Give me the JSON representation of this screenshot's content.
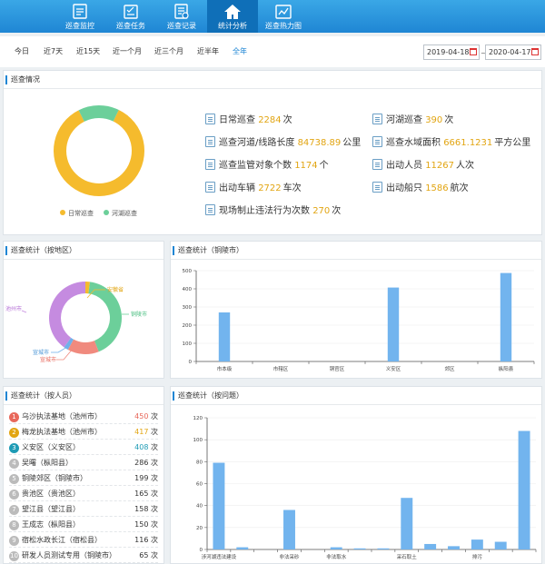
{
  "nav": {
    "items": [
      {
        "label": "巡查监控",
        "icon": "monitor-icon"
      },
      {
        "label": "巡查任务",
        "icon": "task-icon"
      },
      {
        "label": "巡查记录",
        "icon": "record-icon"
      },
      {
        "label": "统计分析",
        "icon": "home-icon",
        "active": true
      },
      {
        "label": "巡查热力图",
        "icon": "heatmap-icon"
      }
    ]
  },
  "filter": {
    "ranges": [
      "今日",
      "近7天",
      "近15天",
      "近一个月",
      "近三个月",
      "近半年",
      "全年"
    ],
    "active_range": "全年",
    "start_date": "2019-04-18",
    "end_date": "2020-04-17",
    "separator": "~"
  },
  "overview": {
    "title": "巡查情况",
    "donut": {
      "slices": [
        {
          "name": "日常巡查",
          "value": 2284,
          "color": "#f5bb2d"
        },
        {
          "name": "河湖巡查",
          "value": 390,
          "color": "#6ccf9a"
        }
      ]
    },
    "stats": [
      {
        "label": "日常巡查",
        "value": "2284",
        "unit": "次"
      },
      {
        "label": "河湖巡查",
        "value": "390",
        "unit": "次"
      },
      {
        "label": "巡查河道/线路长度",
        "value": "84738.89",
        "unit": "公里"
      },
      {
        "label": "巡查水域面积",
        "value": "6661.1231",
        "unit": "平方公里"
      },
      {
        "label": "巡查监管对象个数",
        "value": "1174",
        "unit": "个"
      },
      {
        "label": "出动人员",
        "value": "11267",
        "unit": "人次"
      },
      {
        "label": "出动车辆",
        "value": "2722",
        "unit": "车次"
      },
      {
        "label": "出动船只",
        "value": "1586",
        "unit": "航次"
      },
      {
        "label": "现场制止违法行为次数",
        "value": "270",
        "unit": "次"
      }
    ]
  },
  "by_area": {
    "title": "巡查统计（按地区）",
    "slices": [
      {
        "name": "安徽省",
        "value": 2,
        "color": "#f5bb2d"
      },
      {
        "name": "铜陵市",
        "value": 42,
        "color": "#6ccf9a"
      },
      {
        "name": "宣城市",
        "value": 14,
        "color": "#f08a7e"
      },
      {
        "name": "池州市",
        "value": 2,
        "color": "#6fb0ea"
      },
      {
        "name": "池州市",
        "value": 40,
        "color": "#c58be0"
      }
    ],
    "labels": {
      "anhui": "安徽省",
      "tongling": "铜陵市",
      "xuancheng": "宣城市",
      "xuancheng2": "宣城市",
      "chizhou": "池州市"
    }
  },
  "city_chart": {
    "title": "巡查统计（铜陵市）",
    "chart_data": {
      "type": "bar",
      "categories": [
        "市本级",
        "市辖区",
        "铜官区",
        "义安区",
        "郊区",
        "枞阳县"
      ],
      "values": [
        270,
        0,
        0,
        407,
        0,
        487
      ],
      "ylim": [
        0,
        500
      ],
      "yticks": [
        0,
        100,
        200,
        300,
        400,
        500
      ],
      "color": "#72b4ee"
    }
  },
  "by_person": {
    "title": "巡查统计（按人员）",
    "rows": [
      {
        "rank": "1",
        "name": "乌沙执法基地（池州市）",
        "value": "450",
        "unit": "次",
        "color": "#e8685b"
      },
      {
        "rank": "2",
        "name": "梅龙执法基地（池州市）",
        "value": "417",
        "unit": "次",
        "color": "#e2a512"
      },
      {
        "rank": "3",
        "name": "义安区（义安区）",
        "value": "408",
        "unit": "次",
        "color": "#1e9bb5"
      },
      {
        "rank": "4",
        "name": "吴曙（枞阳县）",
        "value": "286",
        "unit": "次",
        "color": "#333333"
      },
      {
        "rank": "5",
        "name": "铜陵郊区（铜陵市）",
        "value": "199",
        "unit": "次",
        "color": "#333333"
      },
      {
        "rank": "6",
        "name": "贵池区（贵池区）",
        "value": "165",
        "unit": "次",
        "color": "#333333"
      },
      {
        "rank": "7",
        "name": "望江县（望江县）",
        "value": "158",
        "unit": "次",
        "color": "#333333"
      },
      {
        "rank": "8",
        "name": "王成志（枞阳县）",
        "value": "150",
        "unit": "次",
        "color": "#333333"
      },
      {
        "rank": "9",
        "name": "宿松水政长江（宿松县）",
        "value": "116",
        "unit": "次",
        "color": "#333333"
      },
      {
        "rank": "10",
        "name": "研发人员测试专用（铜陵市）",
        "value": "65",
        "unit": "次",
        "color": "#333333"
      }
    ]
  },
  "problem_chart": {
    "title": "巡查统计（按问题）",
    "chart_data": {
      "type": "bar",
      "categories": [
        "涉河湖违法建设",
        "",
        "",
        "非法采砂",
        "",
        "非法取水",
        "",
        "",
        "采石取土",
        "",
        "",
        "排污",
        "",
        ""
      ],
      "values": [
        79,
        2,
        0,
        36,
        0,
        2,
        1,
        1,
        47,
        5,
        3,
        9,
        7,
        108
      ],
      "ylim": [
        0,
        120
      ],
      "yticks": [
        0,
        20,
        40,
        60,
        80,
        100,
        120
      ],
      "color": "#72b4ee"
    }
  }
}
